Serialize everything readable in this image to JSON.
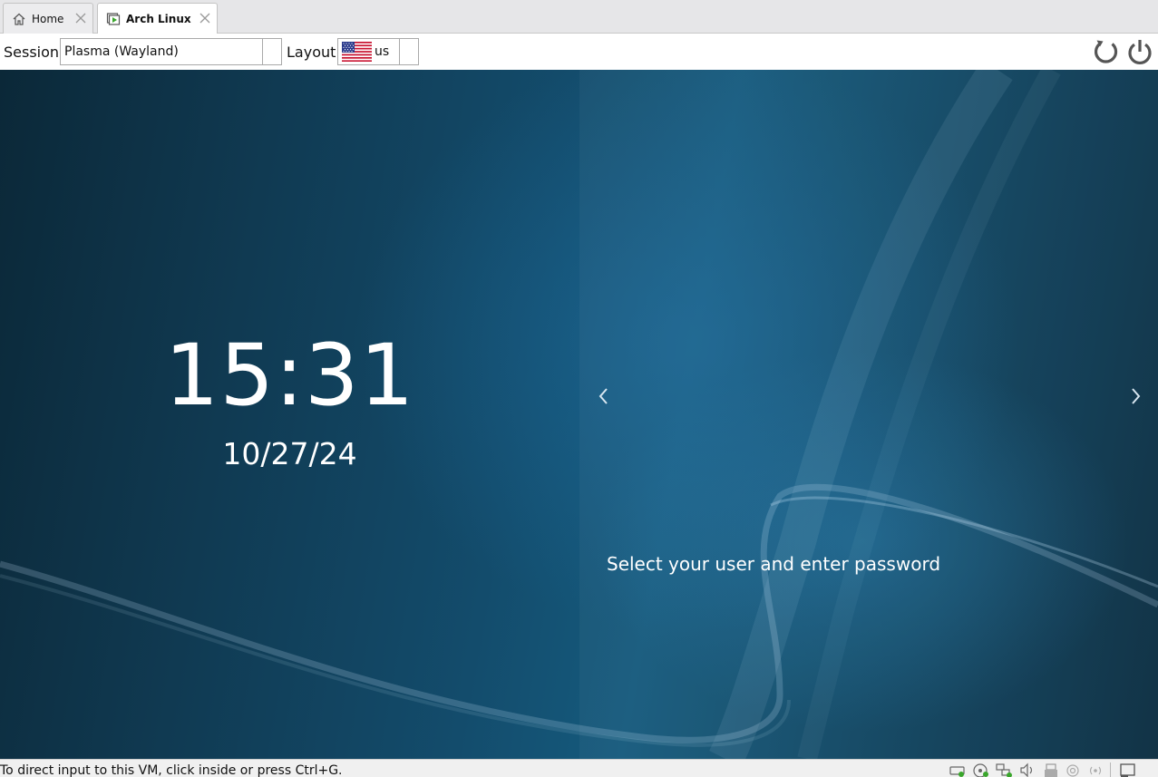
{
  "tabs": [
    {
      "label": "Home",
      "icon": "home-icon",
      "active": false
    },
    {
      "label": "Arch Linux",
      "icon": "vm-running-icon",
      "active": true
    }
  ],
  "toolbar": {
    "session_label": "Session",
    "session_value": "Plasma (Wayland)",
    "layout_label": "Layout",
    "layout_value": "us",
    "layout_flag": "us-flag-icon"
  },
  "login": {
    "time": "15:31",
    "date": "10/27/24",
    "prompt": "Select your user and enter password"
  },
  "statusbar": {
    "message": "To direct input to this VM, click inside or press Ctrl+G.",
    "icons": [
      "hard-disk-icon",
      "optical-drive-icon",
      "network-icon",
      "audio-icon",
      "usb-icon",
      "shared-folder-icon",
      "recording-icon",
      "display-icon"
    ]
  },
  "colors": {
    "accent_green": "#3aa62c",
    "wallpaper_dark": "#0b2838",
    "wallpaper_mid": "#155a7d"
  }
}
